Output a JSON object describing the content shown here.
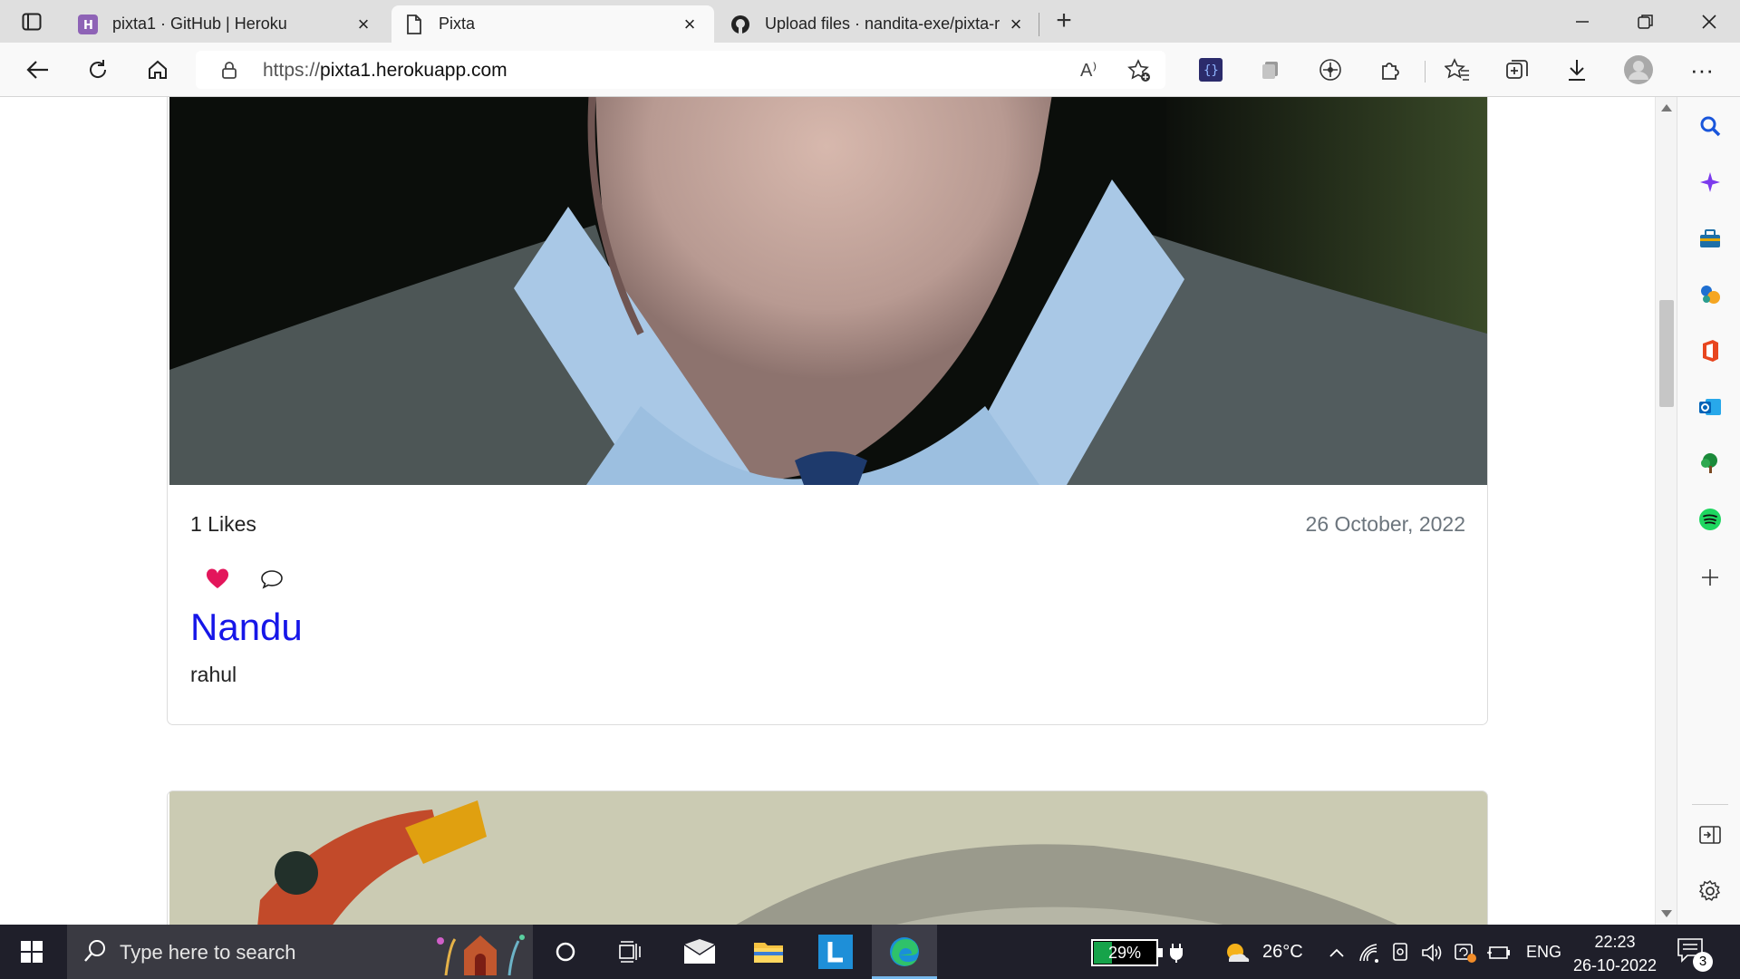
{
  "browser": {
    "tabs": [
      {
        "title": "pixta1 · GitHub | Heroku",
        "favicon": "heroku-icon"
      },
      {
        "title": "Pixta",
        "favicon": "page-icon",
        "active": true
      },
      {
        "title": "Upload files · nandita-exe/pixta-r",
        "favicon": "github-icon"
      }
    ],
    "new_tab_label": "+",
    "close_glyph": "×",
    "url_scheme": "https://",
    "url_host": "pixta1.herokuapp.com",
    "read_aloud_label": "A⁾"
  },
  "post": {
    "likes": "1 Likes",
    "date": "26 October, 2022",
    "author": "Nandu",
    "caption": "rahul",
    "liked": true,
    "like_color": "#e3165b"
  },
  "taskbar": {
    "search_placeholder": "Type here to search",
    "battery_percent": "29%",
    "battery_level": 0.29,
    "weather_temp": "26°C",
    "language": "ENG",
    "time": "22:23",
    "date": "26-10-2022",
    "notification_count": "3"
  },
  "colors": {
    "accent_link": "#1616e8",
    "taskbar_bg": "#1f1f2a",
    "battery_fill": "#16a34a"
  }
}
